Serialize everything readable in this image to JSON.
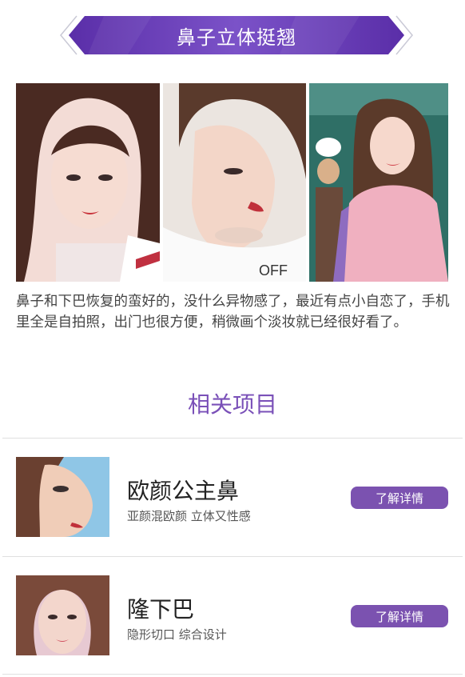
{
  "banner": {
    "title": "鼻子立体挺翘"
  },
  "photos": [
    {
      "name": "patient-selfie-front"
    },
    {
      "name": "patient-profile-side"
    },
    {
      "name": "patient-pink-shirt"
    }
  ],
  "review": {
    "text": "鼻子和下巴恢复的蛮好的，没什么异物感了，最近有点小自恋了，手机里全是自拍照，出门也很方便，稍微画个淡妆就已经很好看了。"
  },
  "related": {
    "title": "相关项目",
    "items": [
      {
        "title": "欧颜公主鼻",
        "subtitle": "亚颜混欧颜 立体又性感",
        "button": "了解详情"
      },
      {
        "title": "隆下巴",
        "subtitle": "隐形切口 综合设计",
        "button": "了解详情"
      }
    ]
  },
  "colors": {
    "accent": "#7b52b0",
    "banner": "#6a3fb3"
  }
}
